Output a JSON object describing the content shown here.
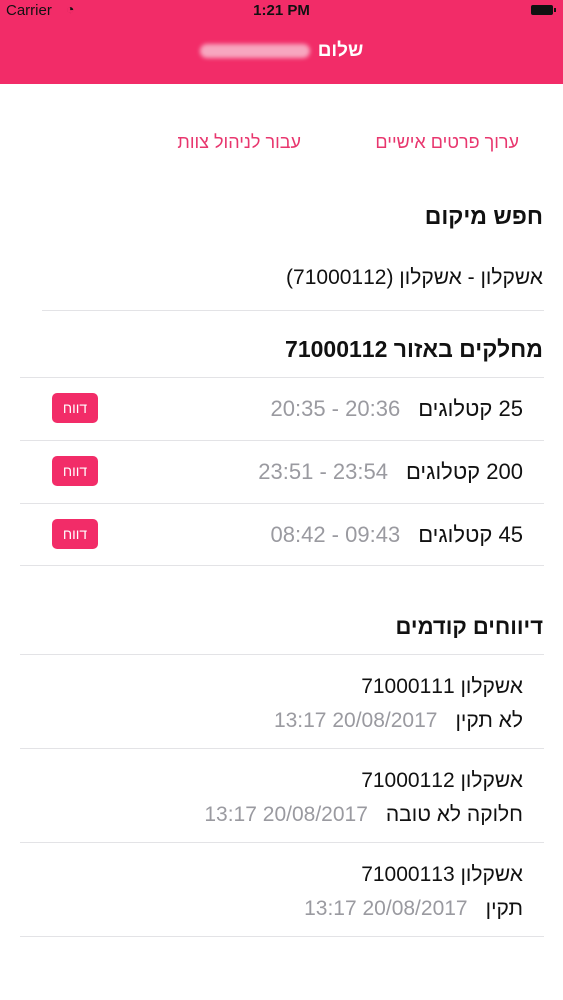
{
  "status_bar": {
    "carrier": "Carrier",
    "wifi_icon": "wifi-icon",
    "time": "1:21 PM",
    "battery_icon": "battery-icon"
  },
  "header": {
    "greeting": "שלום"
  },
  "links": {
    "edit_personal": "ערוך פרטים אישיים",
    "team_management": "עבור לניהול צוות"
  },
  "location": {
    "title": "חפש מיקום",
    "selected": "אשקלון - אשקלון (71000112)"
  },
  "distributors": {
    "title": "מחלקים באזור 71000112",
    "rows": [
      {
        "amount": "25 קטלוגים",
        "times": "20:36 - 20:35",
        "button": "דווח"
      },
      {
        "amount": "200 קטלוגים",
        "times": "23:54 - 23:51",
        "button": "דווח"
      },
      {
        "amount": "45 קטלוגים",
        "times": "09:43 - 08:42",
        "button": "דווח"
      }
    ]
  },
  "previous_reports": {
    "title": "דיווחים קודמים",
    "rows": [
      {
        "area": "אשקלון 71000111",
        "status": "לא תקין",
        "datetime": "20/08/2017 13:17"
      },
      {
        "area": "אשקלון 71000112",
        "status": "חלוקה לא טובה",
        "datetime": "20/08/2017 13:17"
      },
      {
        "area": "אשקלון 71000113",
        "status": "תקין",
        "datetime": "20/08/2017 13:17"
      }
    ]
  },
  "colors": {
    "accent": "#f22c68",
    "link": "#e8366e",
    "muted": "#9a9aa0"
  }
}
